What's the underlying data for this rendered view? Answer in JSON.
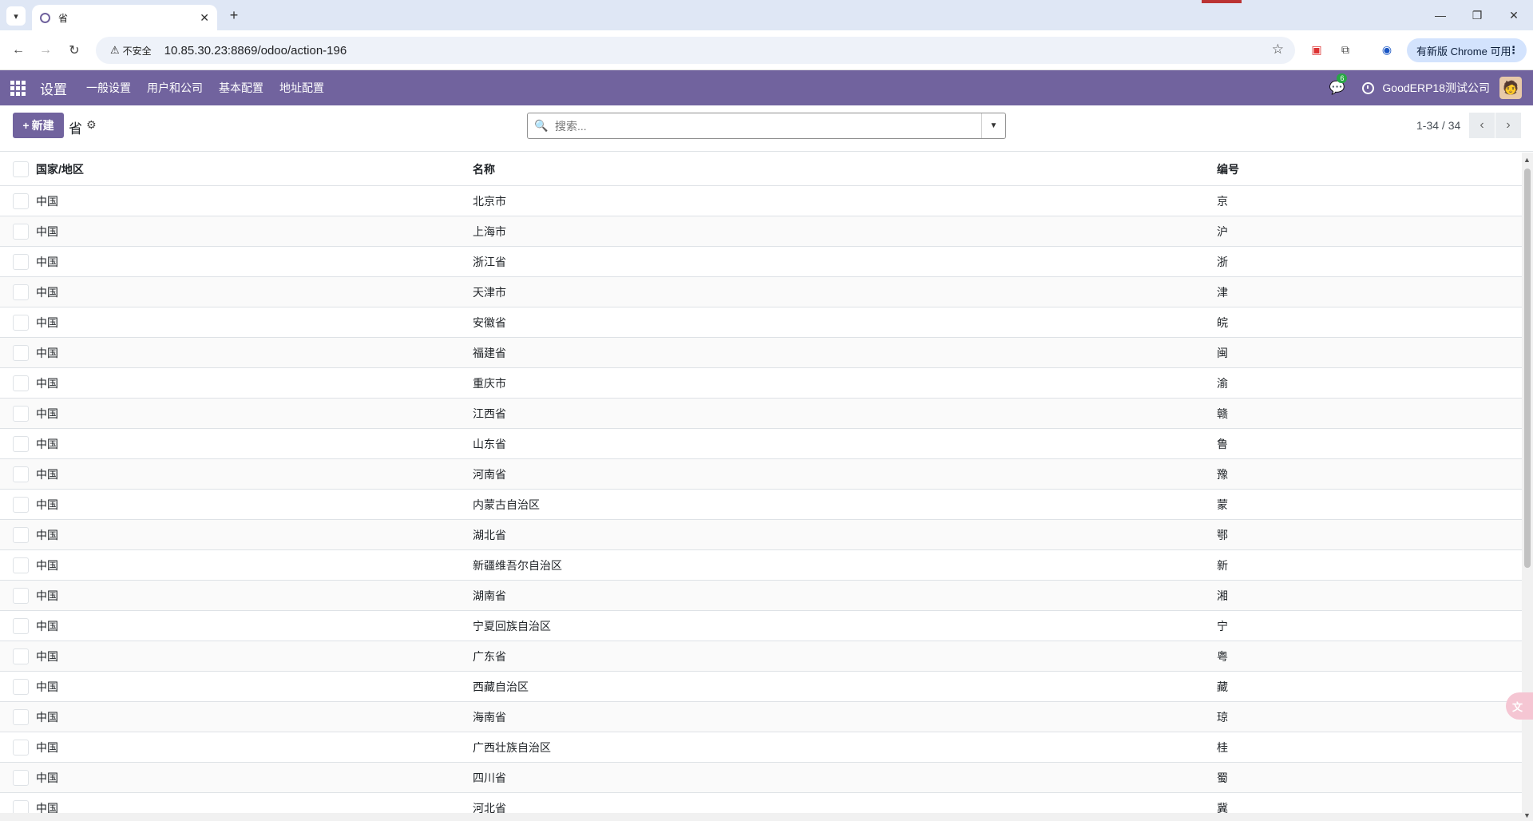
{
  "browser": {
    "tab_title": "省",
    "insecure_label": "不安全",
    "url": "10.85.30.23:8869/odoo/action-196",
    "update_label": "有新版 Chrome 可用"
  },
  "navbar": {
    "brand": "设置",
    "menu": [
      "一般设置",
      "用户和公司",
      "基本配置",
      "地址配置"
    ],
    "chat_count": "6",
    "company": "GoodERP18测试公司"
  },
  "control": {
    "new_label": "新建",
    "breadcrumb": "省",
    "search_placeholder": "搜索...",
    "pager": "1-34 / 34"
  },
  "list": {
    "headers": [
      "国家/地区",
      "名称",
      "编号"
    ],
    "rows": [
      [
        "中国",
        "北京市",
        "京"
      ],
      [
        "中国",
        "上海市",
        "沪"
      ],
      [
        "中国",
        "浙江省",
        "浙"
      ],
      [
        "中国",
        "天津市",
        "津"
      ],
      [
        "中国",
        "安徽省",
        "皖"
      ],
      [
        "中国",
        "福建省",
        "闽"
      ],
      [
        "中国",
        "重庆市",
        "渝"
      ],
      [
        "中国",
        "江西省",
        "赣"
      ],
      [
        "中国",
        "山东省",
        "鲁"
      ],
      [
        "中国",
        "河南省",
        "豫"
      ],
      [
        "中国",
        "内蒙古自治区",
        "蒙"
      ],
      [
        "中国",
        "湖北省",
        "鄂"
      ],
      [
        "中国",
        "新疆维吾尔自治区",
        "新"
      ],
      [
        "中国",
        "湖南省",
        "湘"
      ],
      [
        "中国",
        "宁夏回族自治区",
        "宁"
      ],
      [
        "中国",
        "广东省",
        "粤"
      ],
      [
        "中国",
        "西藏自治区",
        "藏"
      ],
      [
        "中国",
        "海南省",
        "琼"
      ],
      [
        "中国",
        "广西壮族自治区",
        "桂"
      ],
      [
        "中国",
        "四川省",
        "蜀"
      ],
      [
        "中国",
        "河北省",
        "冀"
      ]
    ]
  },
  "colors": {
    "brand": "#71639e",
    "chat_badge": "#28a745"
  }
}
